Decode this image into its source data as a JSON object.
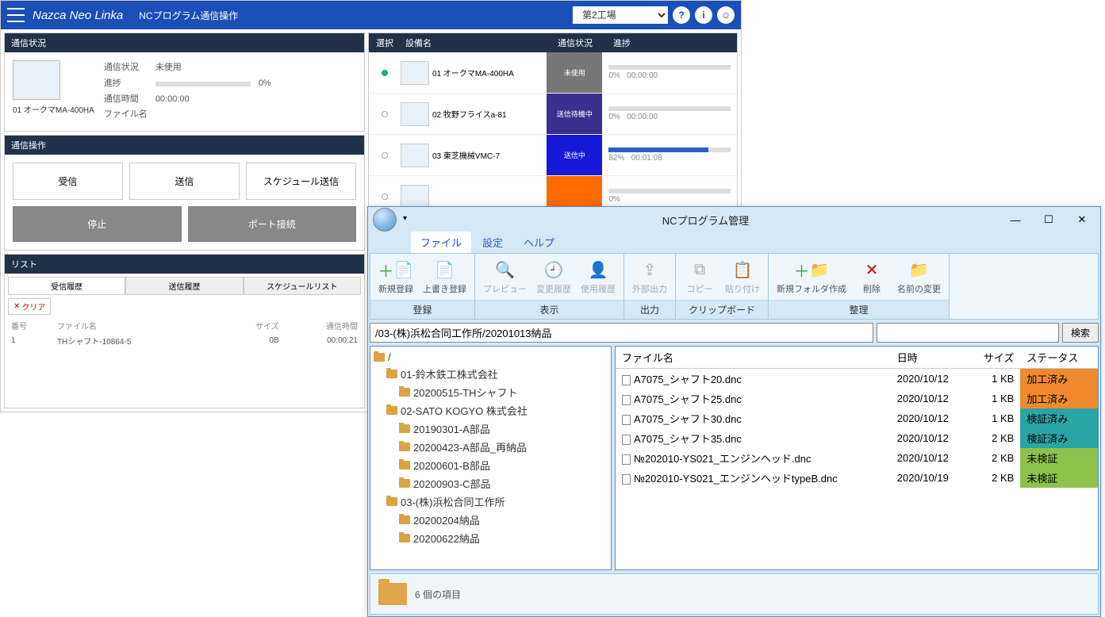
{
  "back": {
    "app_name": "Nazca Neo Linka",
    "page_title": "NCプログラム通信操作",
    "plant_select": "第2工場",
    "status_panel": {
      "title": "通信状況",
      "machine": "01 オークマMA-400HA",
      "rows": {
        "r1k": "通信状況",
        "r1v": "未使用",
        "r2k": "進捗",
        "r2v": "0%",
        "r3k": "通信時間",
        "r3v": "00:00:00",
        "r4k": "ファイル名",
        "r4v": ""
      }
    },
    "ops_panel": {
      "title": "通信操作",
      "btn_recv": "受信",
      "btn_send": "送信",
      "btn_sched": "スケジュール送信",
      "btn_stop": "停止",
      "btn_port": "ポート接続"
    },
    "list_panel": {
      "title": "リスト",
      "tab_recv": "受信履歴",
      "tab_send": "送信履歴",
      "tab_sched": "スケジュールリスト",
      "clear": "クリア",
      "col_no": "番号",
      "col_file": "ファイル名",
      "col_size": "サイズ",
      "col_time": "通信時間",
      "row1": {
        "no": "1",
        "file": "THシャフト-10864-5",
        "size": "0B",
        "time": "00:00:21"
      }
    },
    "right_table": {
      "h_sel": "選択",
      "h_name": "設備名",
      "h_stat": "通信状況",
      "h_prog": "進捗",
      "rows": [
        {
          "name": "01 オークマMA-400HA",
          "status": "未使用",
          "color": "#777",
          "pct": 0,
          "pct_txt": "0%",
          "time": "00:00:00",
          "selected": true
        },
        {
          "name": "02 牧野フライスa-81",
          "status": "送信待機中",
          "color": "#3a2f8f",
          "pct": 0,
          "pct_txt": "0%",
          "time": "00:00:00",
          "selected": false
        },
        {
          "name": "03 東芝機械VMC-7",
          "status": "送信中",
          "color": "#1818d8",
          "pct": 82,
          "pct_txt": "82%",
          "time": "00:01:08",
          "selected": false
        },
        {
          "name": "",
          "status": "",
          "color": "#ff6a00",
          "pct": 0,
          "pct_txt": "0%",
          "time": "",
          "selected": false
        }
      ]
    }
  },
  "front": {
    "title": "NCプログラム管理",
    "menus": {
      "file": "ファイル",
      "settings": "設定",
      "help": "ヘルプ"
    },
    "ribbon": {
      "g_reg": {
        "label": "登録",
        "new": "新規登録",
        "over": "上書き登録"
      },
      "g_view": {
        "label": "表示",
        "preview": "プレビュー",
        "hist": "変更履歴",
        "use": "使用履歴"
      },
      "g_out": {
        "label": "出力",
        "export": "外部出力"
      },
      "g_clip": {
        "label": "クリップボード",
        "copy": "コピー",
        "paste": "貼り付け"
      },
      "g_org": {
        "label": "整理",
        "newf": "新規フォルダ作成",
        "del": "削除",
        "ren": "名前の変更"
      }
    },
    "path": "/03-(株)浜松合同工作所/20201013納品",
    "search_btn": "検索",
    "tree": [
      {
        "ind": 0,
        "label": "/"
      },
      {
        "ind": 1,
        "label": "01-鈴木鉄工株式会社"
      },
      {
        "ind": 2,
        "label": "20200515-THシャフト"
      },
      {
        "ind": 1,
        "label": "02-SATO KOGYO 株式会社"
      },
      {
        "ind": 2,
        "label": "20190301-A部品"
      },
      {
        "ind": 2,
        "label": "20200423-A部品_再納品"
      },
      {
        "ind": 2,
        "label": "20200601-B部品"
      },
      {
        "ind": 2,
        "label": "20200903-C部品"
      },
      {
        "ind": 1,
        "label": "03-(株)浜松合同工作所"
      },
      {
        "ind": 2,
        "label": "20200204納品"
      },
      {
        "ind": 2,
        "label": "20200622納品"
      }
    ],
    "file_cols": {
      "name": "ファイル名",
      "date": "日時",
      "size": "サイズ",
      "status": "ステータス"
    },
    "files": [
      {
        "name": "A7075_シャフト20.dnc",
        "date": "2020/10/12",
        "size": "1 KB",
        "status": "加工済み",
        "color": "#ef8a2e"
      },
      {
        "name": "A7075_シャフト25.dnc",
        "date": "2020/10/12",
        "size": "1 KB",
        "status": "加工済み",
        "color": "#ef8a2e"
      },
      {
        "name": "A7075_シャフト30.dnc",
        "date": "2020/10/12",
        "size": "1 KB",
        "status": "検証済み",
        "color": "#2aa5a5"
      },
      {
        "name": "A7075_シャフト35.dnc",
        "date": "2020/10/12",
        "size": "2 KB",
        "status": "検証済み",
        "color": "#2aa5a5"
      },
      {
        "name": "№202010-YS021_エンジンヘッド.dnc",
        "date": "2020/10/12",
        "size": "2 KB",
        "status": "未検証",
        "color": "#8fc24a"
      },
      {
        "name": "№202010-YS021_エンジンヘッドtypeB.dnc",
        "date": "2020/10/19",
        "size": "2 KB",
        "status": "未検証",
        "color": "#8fc24a"
      }
    ],
    "statusbar": "6 個の項目"
  }
}
